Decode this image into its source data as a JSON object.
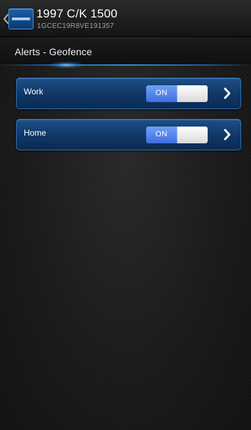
{
  "header": {
    "back_icon": "chevron-left-icon",
    "vehicle_icon": "vehicle-thumbnail-icon",
    "vehicle_title": "1997 C/K 1500",
    "vin": "1GCEC19R8VE191357"
  },
  "section": {
    "title": "Alerts - Geofence"
  },
  "geofences": [
    {
      "label": "Work",
      "toggle_label": "ON",
      "enabled": true,
      "chevron_icon": "chevron-right-icon"
    },
    {
      "label": "Home",
      "toggle_label": "ON",
      "enabled": true,
      "chevron_icon": "chevron-right-icon"
    }
  ],
  "colors": {
    "row_blue": "#0f3766",
    "toggle_on_blue": "#4f80ea",
    "accent_glow": "#3b8ad8",
    "background": "#1c1c1c"
  }
}
